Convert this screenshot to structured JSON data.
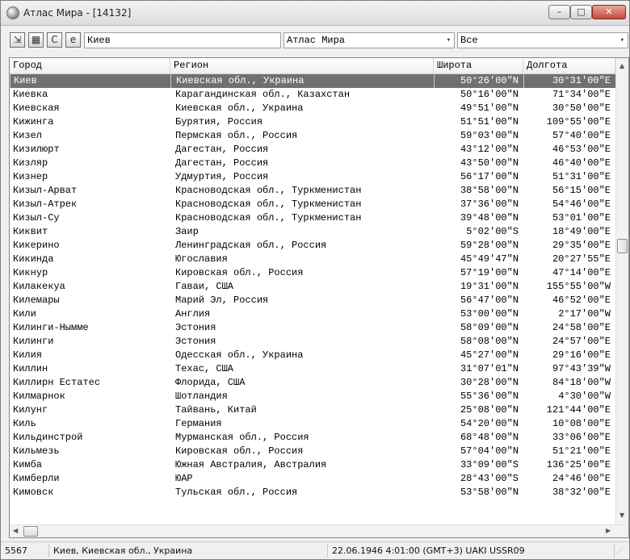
{
  "window": {
    "title": "Атлас Мира - [14132]",
    "min_glyph": "–",
    "max_glyph": "□",
    "close_glyph": "✕"
  },
  "toolbar": {
    "btn_export_glyph": "⇲",
    "btn_calc_glyph": "▦",
    "btn_c_glyph": "C",
    "btn_web_glyph": "e",
    "search_value": "Киев",
    "atlas_value": "Атлас Мира",
    "filter_value": "Все",
    "dropdown_glyph": "▾"
  },
  "table": {
    "headers": [
      "Город",
      "Регион",
      "Широта",
      "Долгота"
    ],
    "rows": [
      [
        "Киев",
        "Киевская обл., Украина",
        "50°26'00\"N",
        "30°31'00\"E"
      ],
      [
        "Киевка",
        "Карагандинская обл., Казахстан",
        "50°16'00\"N",
        "71°34'00\"E"
      ],
      [
        "Киевская",
        "Киевская обл., Украина",
        "49°51'00\"N",
        "30°50'00\"E"
      ],
      [
        "Кижинга",
        "Бурятия, Россия",
        "51°51'00\"N",
        "109°55'00\"E"
      ],
      [
        "Кизел",
        "Пермская обл., Россия",
        "59°03'00\"N",
        "57°40'00\"E"
      ],
      [
        "Кизилюрт",
        "Дагестан, Россия",
        "43°12'00\"N",
        "46°53'00\"E"
      ],
      [
        "Кизляр",
        "Дагестан, Россия",
        "43°50'00\"N",
        "46°40'00\"E"
      ],
      [
        "Кизнер",
        "Удмуртия, Россия",
        "56°17'00\"N",
        "51°31'00\"E"
      ],
      [
        "Кизыл-Арват",
        "Красноводская обл., Туркменистан",
        "38°58'00\"N",
        "56°15'00\"E"
      ],
      [
        "Кизыл-Атрек",
        "Красноводская обл., Туркменистан",
        "37°36'00\"N",
        "54°46'00\"E"
      ],
      [
        "Кизыл-Су",
        "Красноводская обл., Туркменистан",
        "39°48'00\"N",
        "53°01'00\"E"
      ],
      [
        "Киквит",
        "Заир",
        "5°02'00\"S",
        "18°49'00\"E"
      ],
      [
        "Кикерино",
        "Ленинградская обл., Россия",
        "59°28'00\"N",
        "29°35'00\"E"
      ],
      [
        "Кикинда",
        "Югославия",
        "45°49'47\"N",
        "20°27'55\"E"
      ],
      [
        "Кикнур",
        "Кировская обл., Россия",
        "57°19'00\"N",
        "47°14'00\"E"
      ],
      [
        "Килакекуа",
        "Гаваи, США",
        "19°31'00\"N",
        "155°55'00\"W"
      ],
      [
        "Килемары",
        "Марий Эл, Россия",
        "56°47'00\"N",
        "46°52'00\"E"
      ],
      [
        "Кили",
        "Англия",
        "53°00'00\"N",
        "2°17'00\"W"
      ],
      [
        "Килинги-Нымме",
        "Эстония",
        "58°09'00\"N",
        "24°58'00\"E"
      ],
      [
        "Килинги",
        "Эстония",
        "58°08'00\"N",
        "24°57'00\"E"
      ],
      [
        "Килия",
        "Одесская обл., Украина",
        "45°27'00\"N",
        "29°16'00\"E"
      ],
      [
        "Киллин",
        "Техас, США",
        "31°07'01\"N",
        "97°43'39\"W"
      ],
      [
        "Киллирн Естатес",
        "Флорида, США",
        "30°28'00\"N",
        "84°18'00\"W"
      ],
      [
        "Килмарнок",
        "Шотландия",
        "55°36'00\"N",
        "4°30'00\"W"
      ],
      [
        "Килунг",
        "Тайвань, Китай",
        "25°08'00\"N",
        "121°44'00\"E"
      ],
      [
        "Киль",
        "Германия",
        "54°20'00\"N",
        "10°08'00\"E"
      ],
      [
        "Кильдинстрой",
        "Мурманская обл., Россия",
        "68°48'00\"N",
        "33°06'00\"E"
      ],
      [
        "Кильмезь",
        "Кировская обл., Россия",
        "57°04'00\"N",
        "51°21'00\"E"
      ],
      [
        "Кимба",
        "Южная Австралия, Австралия",
        "33°09'00\"S",
        "136°25'00\"E"
      ],
      [
        "Кимберли",
        "ЮАР",
        "28°43'00\"S",
        "24°46'00\"E"
      ],
      [
        "Кимовск",
        "Тульская обл., Россия",
        "53°58'00\"N",
        "38°32'00\"E"
      ]
    ]
  },
  "scroll": {
    "up_glyph": "▲",
    "down_glyph": "▼",
    "left_glyph": "◀",
    "right_glyph": "▶"
  },
  "status": {
    "count": "5567",
    "location": "Киев, Киевская обл., Украина",
    "datetime": "22.06.1946  4:01:00 (GMT+3) UAKI USSR09",
    "grip_glyph": "⋰"
  }
}
